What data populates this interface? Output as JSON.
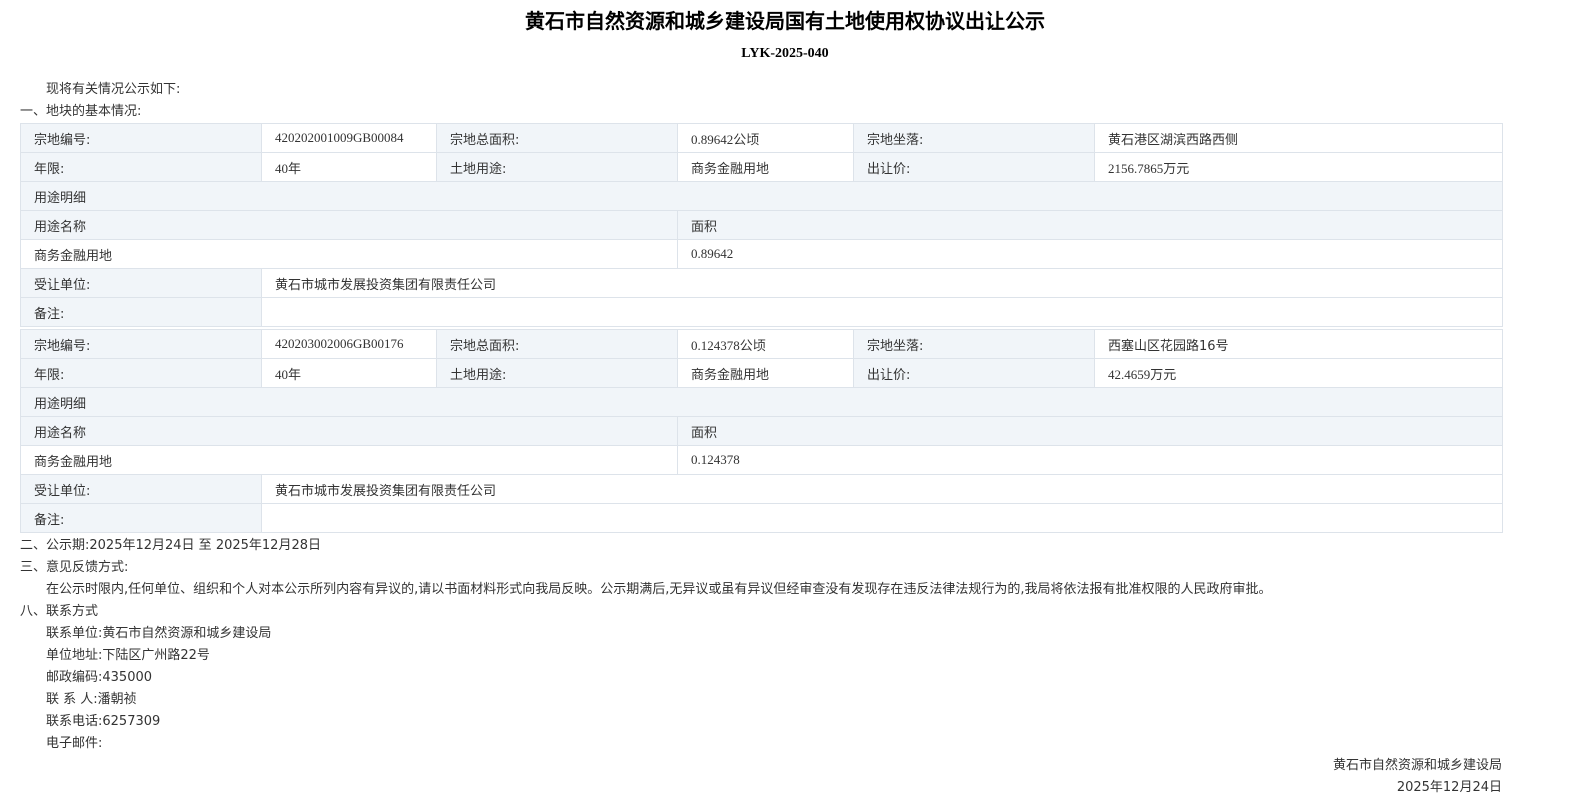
{
  "header": {
    "title": "黄石市自然资源和城乡建设局国有土地使用权协议出让公示",
    "doc_no": "LYK-2025-040"
  },
  "intro": "现将有关情况公示如下:",
  "section1_title": "一、地块的基本情况:",
  "labels": {
    "parcel_no": "宗地编号:",
    "total_area": "宗地总面积:",
    "location": "宗地坐落:",
    "term": "年限:",
    "land_use": "土地用途:",
    "price": "出让价:",
    "use_detail": "用途明细",
    "use_name": "用途名称",
    "area": "面积",
    "grantee": "受让单位:",
    "remarks": "备注:"
  },
  "parcels": [
    {
      "parcel_no": "420202001009GB00084",
      "total_area": "0.89642公顷",
      "location": "黄石港区湖滨西路西侧",
      "term": "40年",
      "land_use": "商务金融用地",
      "price": "2156.7865万元",
      "use_name": "商务金融用地",
      "use_area": "0.89642",
      "grantee": "黄石市城市发展投资集团有限责任公司",
      "remarks": ""
    },
    {
      "parcel_no": "420203002006GB00176",
      "total_area": "0.124378公顷",
      "location": "西塞山区花园路16号",
      "term": "40年",
      "land_use": "商务金融用地",
      "price": "42.4659万元",
      "use_name": "商务金融用地",
      "use_area": "0.124378",
      "grantee": "黄石市城市发展投资集团有限责任公司",
      "remarks": ""
    }
  ],
  "notice_period": "二、公示期:2025年12月24日 至 2025年12月28日",
  "feedback": {
    "title": "三、意见反馈方式:",
    "text": "在公示时限内,任何单位、组织和个人对本公示所列内容有异议的,请以书面材料形式向我局反映。公示期满后,无异议或虽有异议但经审查没有发现存在违反法律法规行为的,我局将依法报有批准权限的人民政府审批。"
  },
  "contact": {
    "title": "八、联系方式",
    "unit": "联系单位:黄石市自然资源和城乡建设局",
    "address": "单位地址:下陆区广州路22号",
    "postcode": "邮政编码:435000",
    "person": "联 系 人:潘朝祯",
    "phone": "联系电话:6257309",
    "email": "电子邮件:"
  },
  "footer": {
    "issuer": "黄石市自然资源和城乡建设局",
    "date": "2025年12月24日"
  }
}
